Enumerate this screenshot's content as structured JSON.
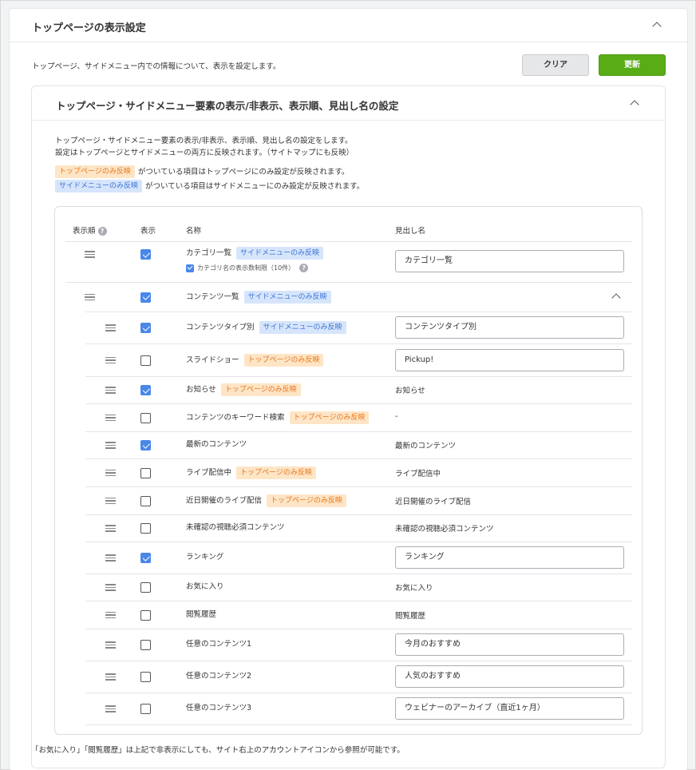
{
  "page": {
    "section_title": "トップページの表示設定",
    "description": "トップページ、サイドメニュー内での情報について、表示を設定します。",
    "clear_label": "クリア",
    "update_label": "更新",
    "footnote": "「お気に入り」「閲覧履歴」は上記で非表示にしても、サイト右上のアカウントアイコンから参照が可能です。"
  },
  "subsection": {
    "title": "トップページ・サイドメニュー要素の表示/非表示、表示順、見出し名の設定",
    "desc_line1": "トップページ・サイドメニュー要素の表示/非表示、表示順、見出し名の設定をします。",
    "desc_line2": "設定はトップページとサイドメニューの両方に反映されます。（サイトマップにも反映）",
    "legend_top_badge": "トップページのみ反映",
    "legend_top_note": "がついている項目はトップページにのみ設定が反映されます。",
    "legend_side_badge": "サイドメニューのみ反映",
    "legend_side_note": "がついている項目はサイドメニューにのみ設定が反映されます。"
  },
  "table": {
    "col_order": "表示順",
    "col_show": "表示",
    "col_name": "名称",
    "col_heading": "見出し名",
    "help_glyph": "?",
    "category_limit_label": "カテゴリ名の表示数制限（10件）",
    "rows": [
      {
        "name": "カテゴリ一覧",
        "checked": true,
        "badge": "サイドメニューのみ反映",
        "badge_type": "side",
        "heading": "カテゴリ一覧",
        "input": true
      },
      {
        "name": "コンテンツ一覧",
        "checked": true,
        "badge": "サイドメニューのみ反映",
        "badge_type": "side",
        "heading": "",
        "input": false
      },
      {
        "name": "コンテンツタイプ別",
        "checked": true,
        "badge": "サイドメニューのみ反映",
        "badge_type": "side",
        "heading": "コンテンツタイプ別",
        "input": true
      },
      {
        "name": "スライドショー",
        "checked": false,
        "badge": "トップページのみ反映",
        "badge_type": "top",
        "heading": "Pickup!",
        "input": true
      },
      {
        "name": "お知らせ",
        "checked": true,
        "badge": "トップページのみ反映",
        "badge_type": "top",
        "heading": "お知らせ",
        "input": false
      },
      {
        "name": "コンテンツのキーワード検索",
        "checked": false,
        "badge": "トップページのみ反映",
        "badge_type": "top",
        "heading": "-",
        "input": false
      },
      {
        "name": "最新のコンテンツ",
        "checked": true,
        "badge": "",
        "badge_type": "",
        "heading": "最新のコンテンツ",
        "input": false
      },
      {
        "name": "ライブ配信中",
        "checked": false,
        "badge": "トップページのみ反映",
        "badge_type": "top",
        "heading": "ライブ配信中",
        "input": false
      },
      {
        "name": "近日開催のライブ配信",
        "checked": false,
        "badge": "トップページのみ反映",
        "badge_type": "top",
        "heading": "近日開催のライブ配信",
        "input": false
      },
      {
        "name": "未確認の視聴必須コンテンツ",
        "checked": false,
        "badge": "",
        "badge_type": "",
        "heading": "未確認の視聴必須コンテンツ",
        "input": false
      },
      {
        "name": "ランキング",
        "checked": true,
        "badge": "",
        "badge_type": "",
        "heading": "ランキング",
        "input": true
      },
      {
        "name": "お気に入り",
        "checked": false,
        "badge": "",
        "badge_type": "",
        "heading": "お気に入り",
        "input": false
      },
      {
        "name": "閲覧履歴",
        "checked": false,
        "badge": "",
        "badge_type": "",
        "heading": "閲覧履歴",
        "input": false
      },
      {
        "name": "任意のコンテンツ1",
        "checked": false,
        "badge": "",
        "badge_type": "",
        "heading": "今月のおすすめ",
        "input": true
      },
      {
        "name": "任意のコンテンツ2",
        "checked": false,
        "badge": "",
        "badge_type": "",
        "heading": "人気のおすすめ",
        "input": true
      },
      {
        "name": "任意のコンテンツ3",
        "checked": false,
        "badge": "",
        "badge_type": "",
        "heading": "ウェビナーのアーカイブ（直近1ヶ月）",
        "input": true
      }
    ]
  },
  "colors": {
    "accent_green": "#5aac16",
    "checkbox_blue": "#4a87e8",
    "badge_top_bg": "#fde5c6",
    "badge_top_text": "#e8781f",
    "badge_side_bg": "#d6e5fb",
    "badge_side_text": "#3b74d6"
  },
  "icons": {
    "collapse": "chevron-up-icon",
    "drag": "drag-handle-icon",
    "help": "help-circle-icon"
  }
}
